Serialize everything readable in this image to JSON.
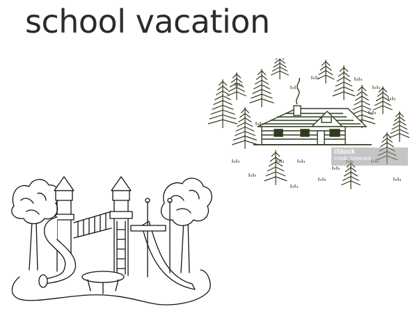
{
  "title": "school vacation",
  "watermark": {
    "brand": "iStock",
    "credit": "Credit: Sylverarts"
  },
  "colors": {
    "title_text": "#2b2b2b",
    "cabin_line": "#2f3a1e",
    "playground_line": "#111111"
  },
  "illustrations": {
    "cabin": "log-cabin-in-pine-forest",
    "playground": "playground-with-slides-and-trees"
  }
}
